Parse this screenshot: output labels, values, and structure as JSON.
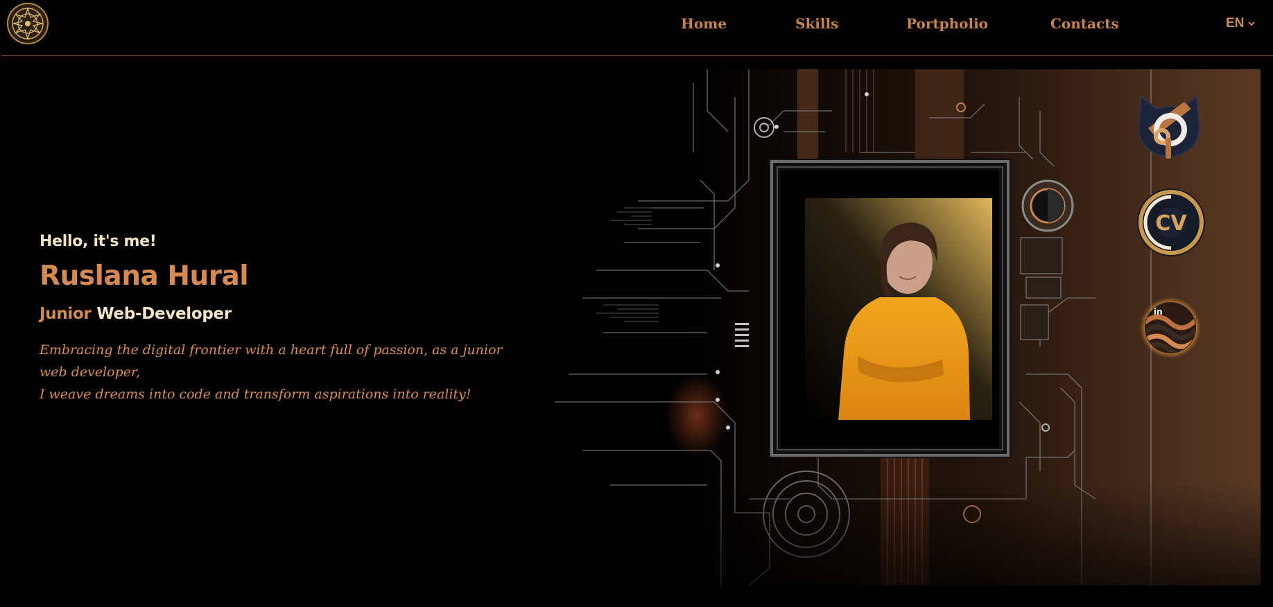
{
  "nav": {
    "home": "Home",
    "skills": "Skills",
    "portfolio": "Portpholio",
    "contacts": "Contacts",
    "language": "EN"
  },
  "hero": {
    "greeting": "Hello, it's me!",
    "name": "Ruslana Hural",
    "role_level": "Junior",
    "role_title": "Web-Developer",
    "tagline_line1": "Embracing the digital frontier with a heart full of passion, as a junior web developer,",
    "tagline_line2": "I weave dreams into code and transform aspirations into reality!"
  },
  "social": {
    "cv_label": "CV",
    "linkedin_label": "in"
  },
  "colors": {
    "accent": "#d78a4f",
    "light_text": "#f3e6c6",
    "background": "#000000",
    "rule": "#8a5a33"
  }
}
